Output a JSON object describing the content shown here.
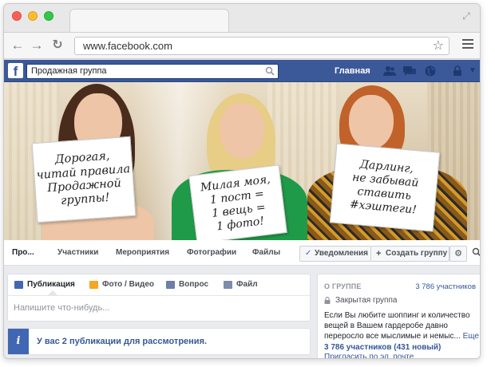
{
  "browser": {
    "url": "www.facebook.com",
    "star_icon": "star-icon",
    "menu_icon": "hamburger-icon"
  },
  "facebook_bar": {
    "logo": "f",
    "search_value": "Продажная группа",
    "home_label": "Главная",
    "colors": {
      "bar": "#3b5998",
      "link": "#365899",
      "accent": "#4267b2"
    }
  },
  "cover": {
    "sign_left": "Дорогая,\nчитай правила\nПродажной\nгруппы!",
    "sign_middle": "Милая моя,\n1 пост =\n1 вещь =\n1 фото!",
    "sign_right": "Дарлинг,\nне забывай\nставить\n#хэштеги!"
  },
  "group_nav": {
    "tabs": [
      "Про...",
      "Участники",
      "Мероприятия",
      "Фотографии",
      "Файлы"
    ],
    "notify_button": "Уведомления",
    "create_group_button": "Создать группу"
  },
  "composer": {
    "tabs": [
      "Публикация",
      "Фото / Видео",
      "Вопрос",
      "Файл"
    ],
    "placeholder": "Напишите что-нибудь..."
  },
  "pending_notice": {
    "text": "У вас 2 публикации для рассмотрения."
  },
  "about": {
    "title": "О ГРУППЕ",
    "member_count": "3 786 участников",
    "privacy": "Закрытая группа",
    "description": "Если Вы любите шоппинг и количество вещей в Вашем гардеробе давно переросло все мыслимые и немыс...",
    "more_link": "Еще",
    "members_line": "3 786 участников (431 новый)",
    "separator": "·",
    "invite_link": "Пригласить по эл. почте"
  }
}
